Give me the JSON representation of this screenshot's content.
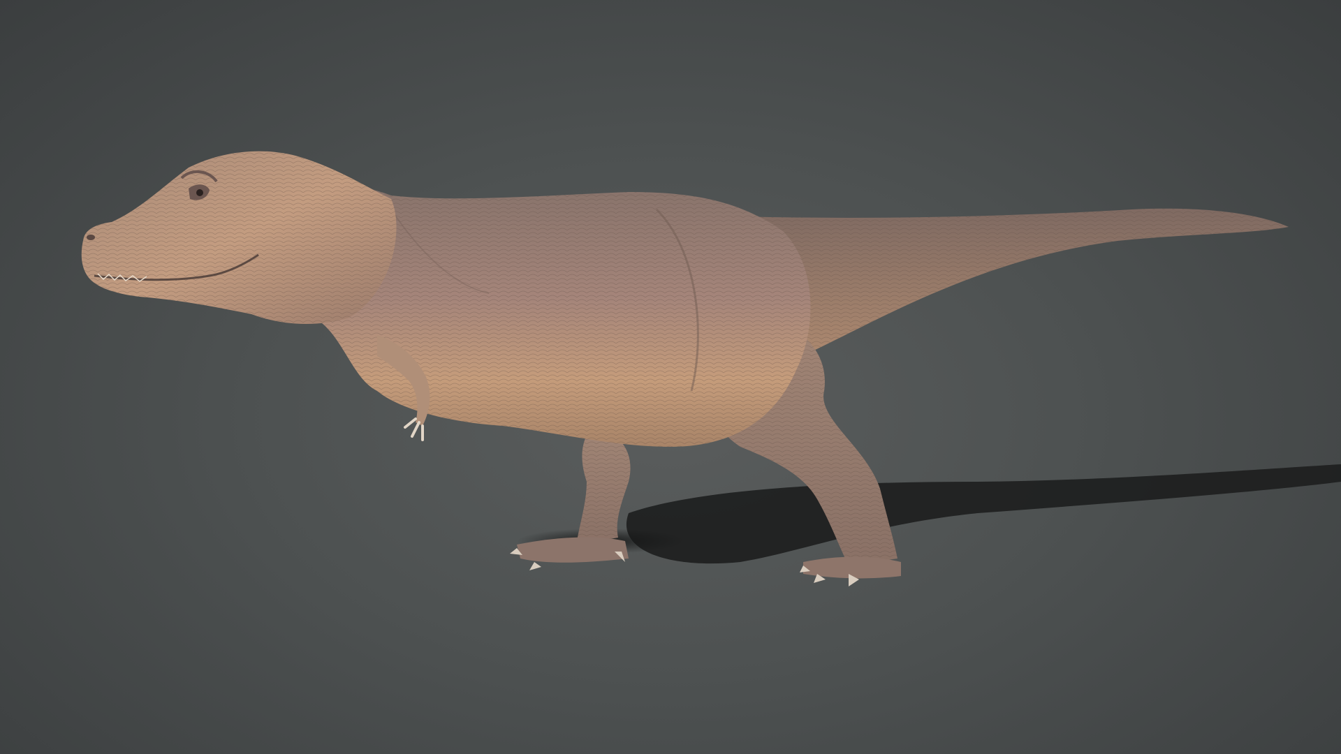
{
  "scene": {
    "subject": "tyrannosaurus-rex-3d-model",
    "colors": {
      "background_center": "#5a5d5d",
      "background_edge": "#3b3e3f",
      "skin_light": "#c9a07c",
      "skin_mid": "#a08070",
      "skin_dark": "#7a6458",
      "shadow": "#1c1d1d"
    }
  }
}
